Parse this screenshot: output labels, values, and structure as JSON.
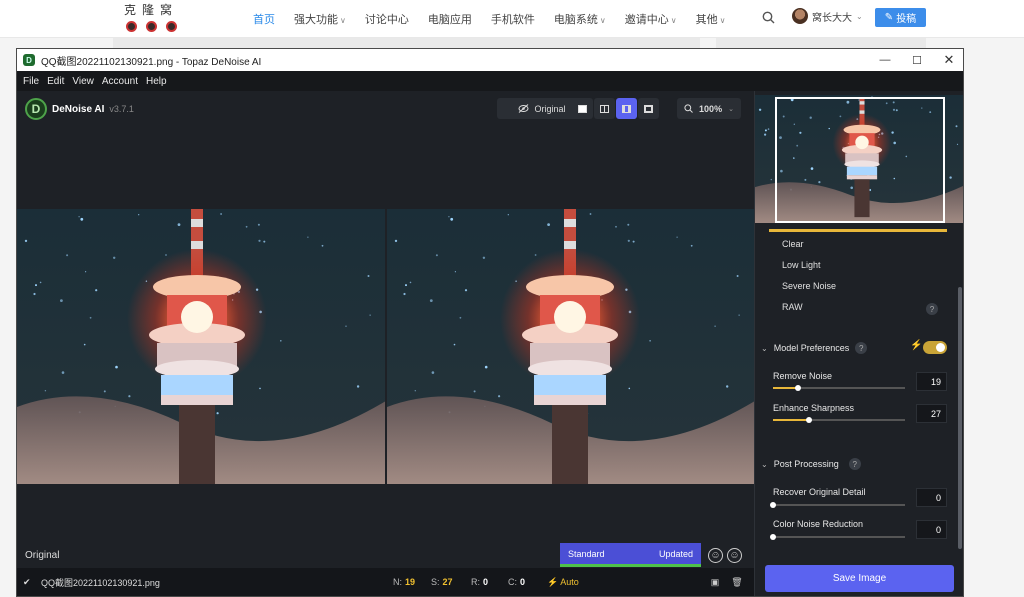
{
  "site": {
    "logo_text": "克隆窝",
    "nav": [
      {
        "label": "首页",
        "active": true,
        "dropdown": false
      },
      {
        "label": "强大功能",
        "active": false,
        "dropdown": true
      },
      {
        "label": "讨论中心",
        "active": false,
        "dropdown": false
      },
      {
        "label": "电脑应用",
        "active": false,
        "dropdown": false
      },
      {
        "label": "手机软件",
        "active": false,
        "dropdown": false
      },
      {
        "label": "电脑系统",
        "active": false,
        "dropdown": true
      },
      {
        "label": "邀请中心",
        "active": false,
        "dropdown": true
      },
      {
        "label": "其他",
        "active": false,
        "dropdown": true
      }
    ],
    "user_name": "窝长大大",
    "post_label": "投稿",
    "accent_color": "#3c8dea"
  },
  "window": {
    "title": "QQ截图20221102130921.png - Topaz DeNoise AI",
    "menu": [
      "File",
      "Edit",
      "View",
      "Account",
      "Help"
    ]
  },
  "app": {
    "brand_name": "DeNoise AI",
    "version": "v3.7.1",
    "original_btn": "Original",
    "zoom": "100%",
    "view_mode_selected": 2
  },
  "viewer": {
    "left_label": "Original",
    "model_name": "Standard",
    "model_status": "Updated"
  },
  "status": {
    "filename": "QQ截图20221102130921.png",
    "n_label": "N:",
    "n_value": "19",
    "s_label": "S:",
    "s_value": "27",
    "r_label": "R:",
    "r_value": "0",
    "c_label": "C:",
    "c_value": "0",
    "auto": "Auto"
  },
  "panel": {
    "options": [
      "Clear",
      "Low Light",
      "Severe Noise",
      "RAW"
    ],
    "model_prefs": "Model Preferences",
    "remove_noise": {
      "label": "Remove Noise",
      "value": "19",
      "level": 0.19
    },
    "enhance_sharpness": {
      "label": "Enhance Sharpness",
      "value": "27",
      "level": 0.27
    },
    "post_processing": "Post Processing",
    "recover_detail": {
      "label": "Recover Original Detail",
      "value": "0",
      "level": 0
    },
    "color_noise": {
      "label": "Color Noise Reduction",
      "value": "0",
      "level": 0
    },
    "save": "Save Image",
    "accent_color": "#5b63f0",
    "yellow": "#e8b73a"
  }
}
